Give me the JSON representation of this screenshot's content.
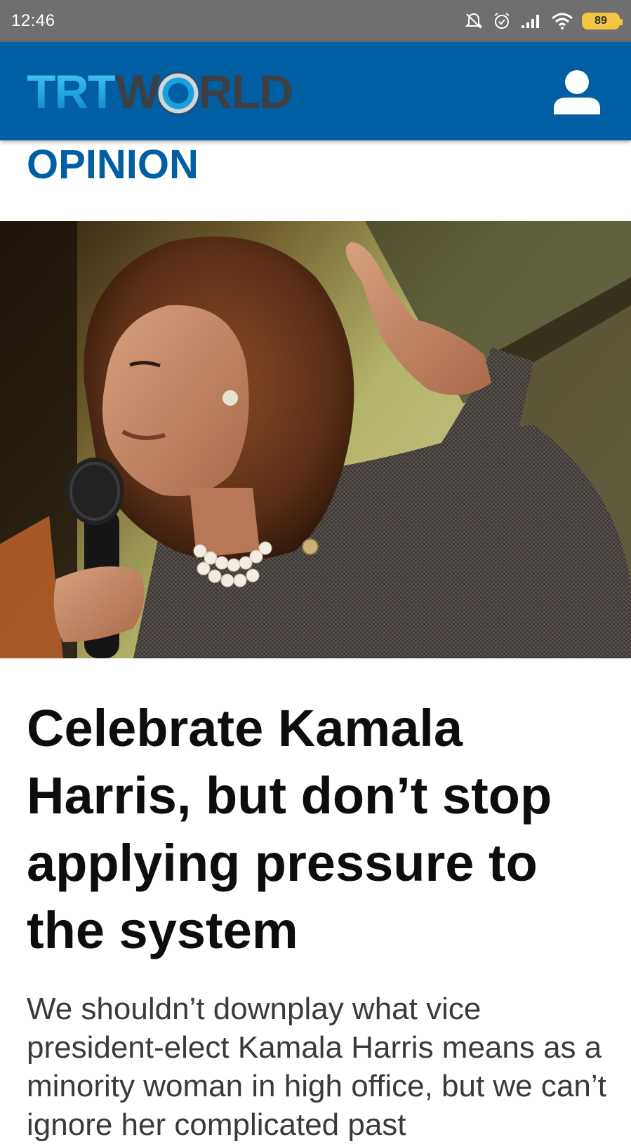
{
  "status_bar": {
    "time": "12:46",
    "battery_level": "89",
    "icons": [
      "mute-icon",
      "alarm-icon",
      "signal-icon",
      "wifi-icon",
      "battery-icon"
    ]
  },
  "header": {
    "logo_text_trt": "TRT",
    "logo_text_w": "W",
    "logo_text_rld": "RLD",
    "brand_color": "#005fa3",
    "account_icon": "user-icon"
  },
  "section": {
    "label": "OPINION"
  },
  "article": {
    "hero_image": "photo-of-kamala-harris-speaking-with-microphone",
    "headline": "Celebrate Kamala Harris, but don’t stop applying pressure to the system",
    "summary": "We shouldn’t downplay what vice president-elect Kamala Harris means as a minority woman in high office, but we can’t ignore her complicated past"
  }
}
